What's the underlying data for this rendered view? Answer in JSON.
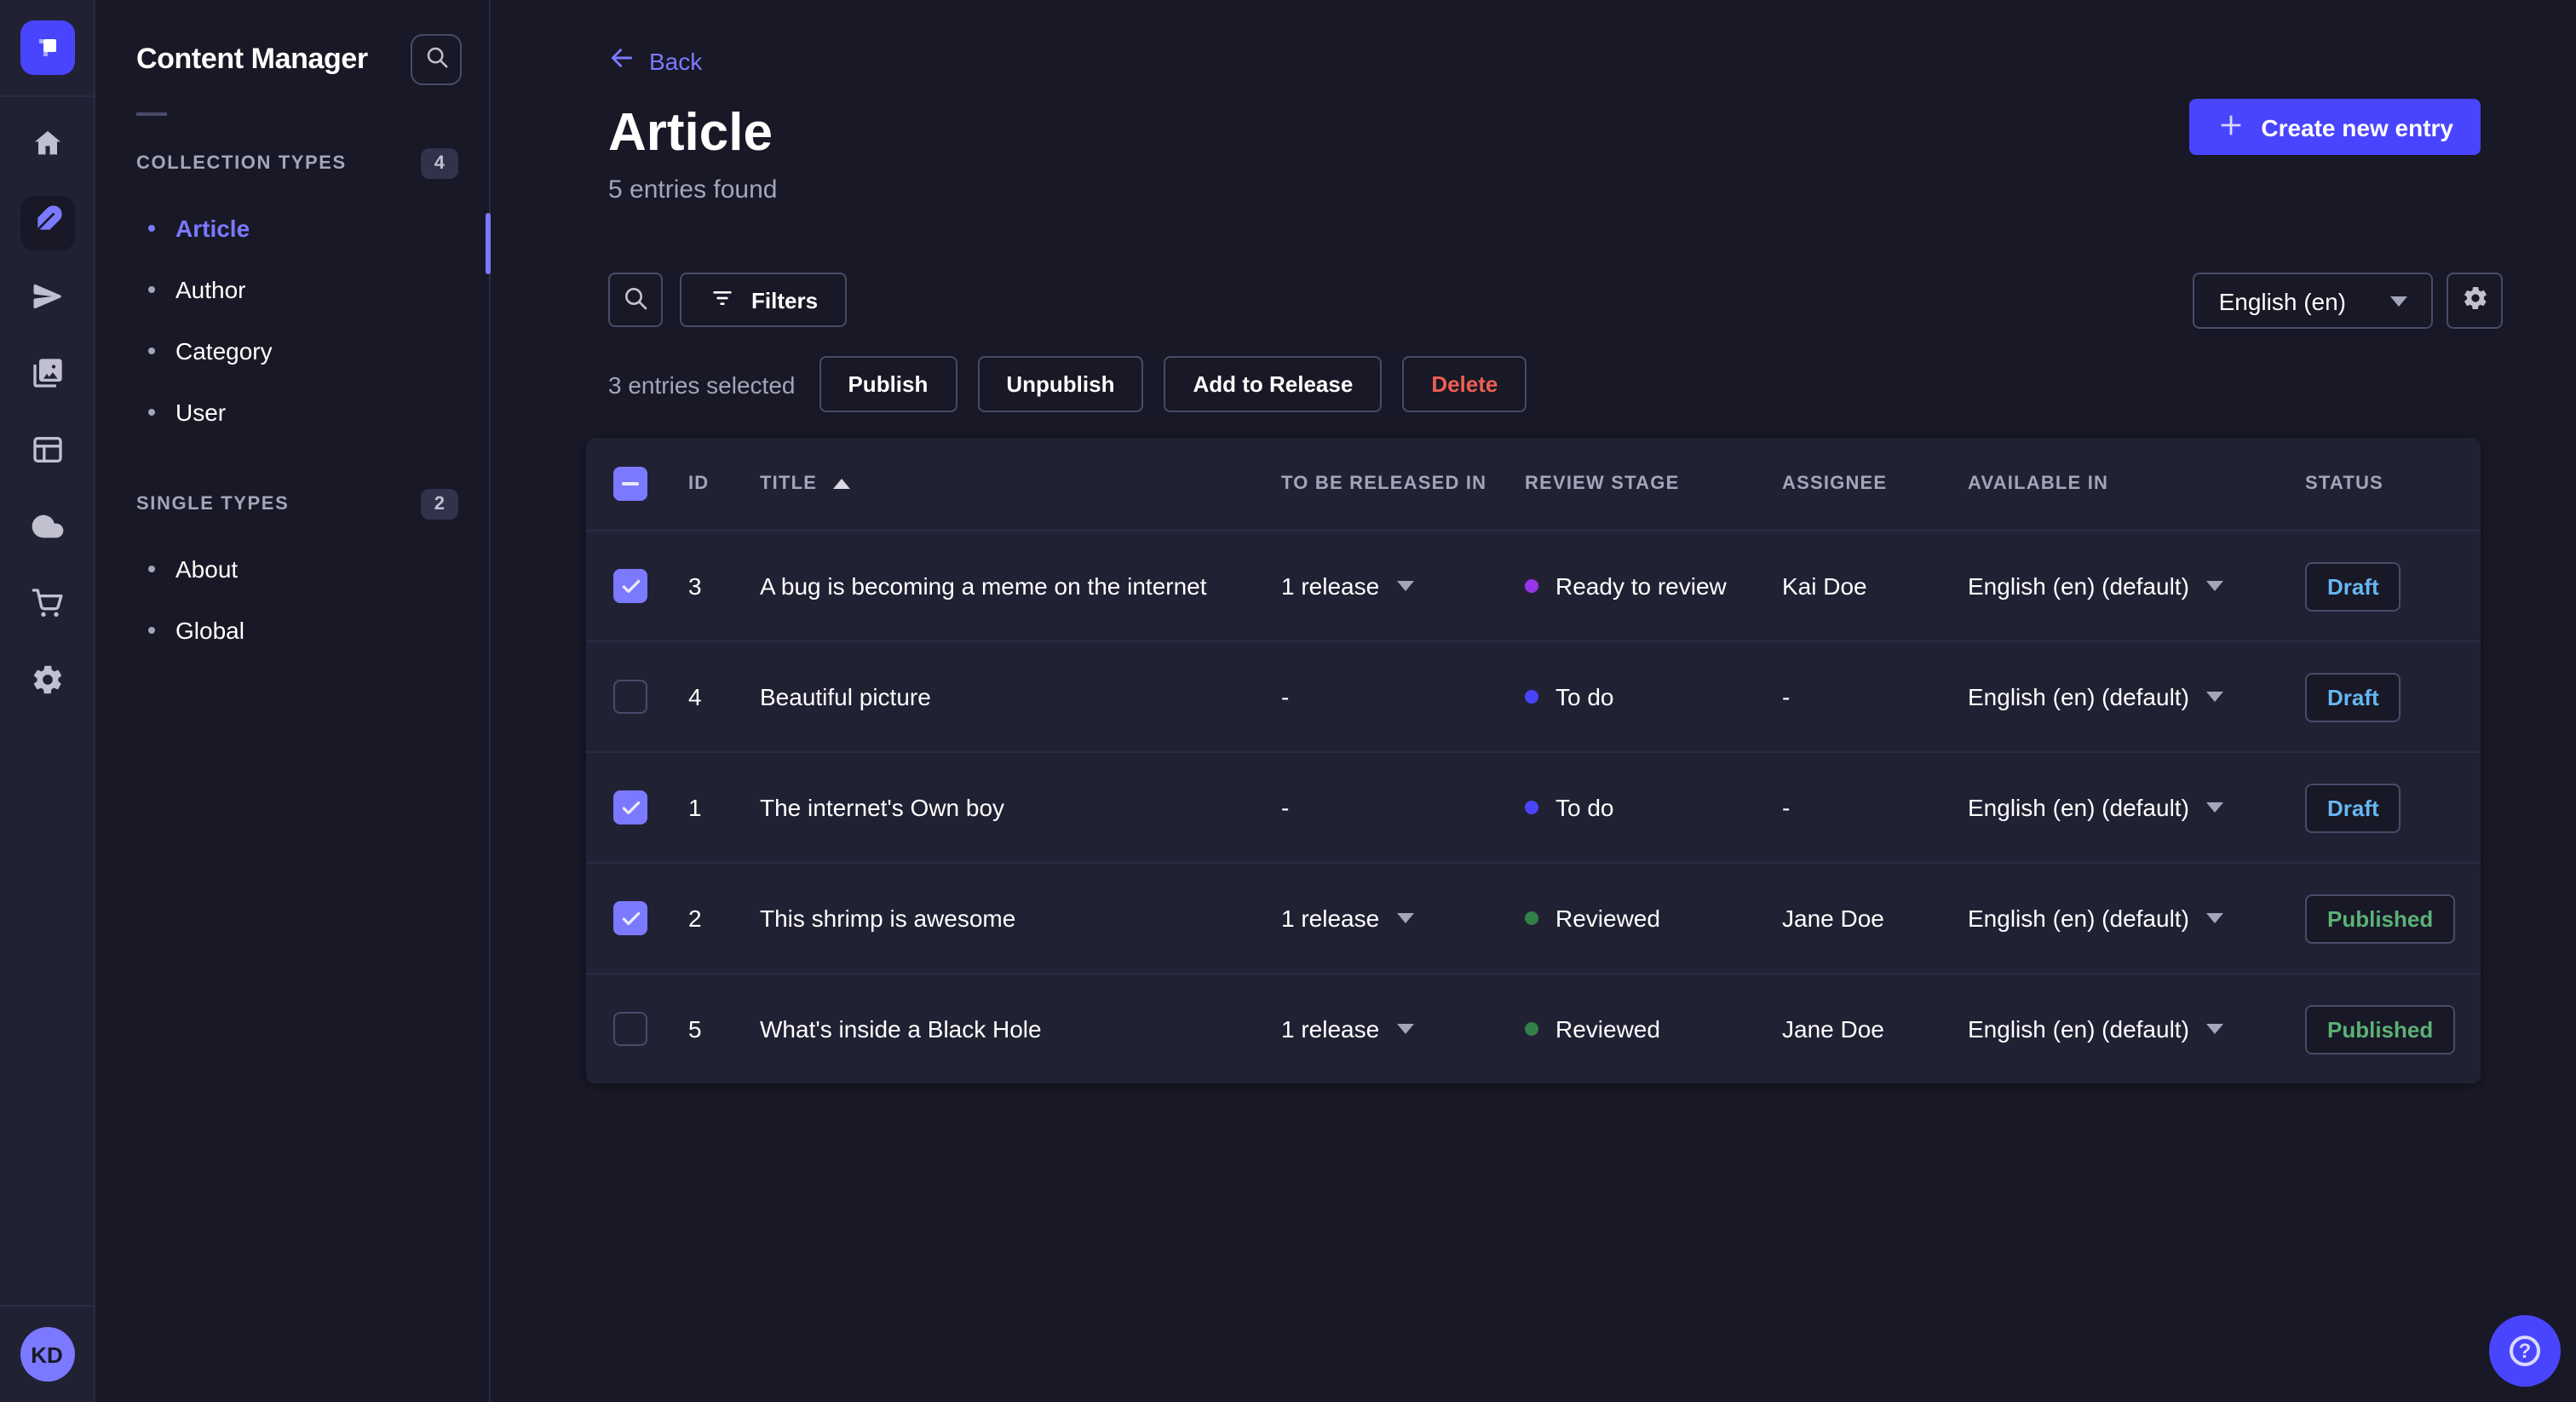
{
  "colors": {
    "accent": "#4945ff",
    "link": "#7b79ff",
    "danger": "#ee5e52",
    "draft": "#66b7f1",
    "published": "#5cb176"
  },
  "rail": {
    "icons": [
      "home",
      "content-manager",
      "releases",
      "media-library",
      "content-type-builder",
      "cloud",
      "marketplace",
      "settings"
    ],
    "active_icon": "content-manager",
    "avatar_initials": "KD"
  },
  "nav": {
    "title": "Content Manager",
    "sections": [
      {
        "label": "COLLECTION TYPES",
        "badge": "4",
        "items": [
          {
            "label": "Article",
            "active": true
          },
          {
            "label": "Author",
            "active": false
          },
          {
            "label": "Category",
            "active": false
          },
          {
            "label": "User",
            "active": false
          }
        ]
      },
      {
        "label": "SINGLE TYPES",
        "badge": "2",
        "items": [
          {
            "label": "About",
            "active": false
          },
          {
            "label": "Global",
            "active": false
          }
        ]
      }
    ]
  },
  "header": {
    "back_label": "Back",
    "title": "Article",
    "subtitle": "5 entries found",
    "create_button": "Create new entry"
  },
  "toolbar": {
    "filters_label": "Filters",
    "locale_value": "English (en)"
  },
  "selection": {
    "label": "3 entries selected",
    "publish": "Publish",
    "unpublish": "Unpublish",
    "add_to_release": "Add to Release",
    "delete": "Delete"
  },
  "table": {
    "header_checkbox_indeterminate": true,
    "sort": {
      "column": "TITLE",
      "direction": "asc"
    },
    "columns": [
      "ID",
      "TITLE",
      "TO BE RELEASED IN",
      "REVIEW STAGE",
      "ASSIGNEE",
      "AVAILABLE IN",
      "STATUS"
    ],
    "rows": [
      {
        "checked": true,
        "id": "3",
        "title": "A bug is becoming a meme on the internet",
        "release": "1 release",
        "has_release": true,
        "stage": "Ready to review",
        "stage_color": "#9736e8",
        "assignee": "Kai Doe",
        "locale": "English (en) (default)",
        "status": "Draft",
        "status_color": "#66b7f1"
      },
      {
        "checked": false,
        "id": "4",
        "title": "Beautiful picture",
        "release": "-",
        "has_release": false,
        "stage": "To do",
        "stage_color": "#4945ff",
        "assignee": "-",
        "locale": "English (en) (default)",
        "status": "Draft",
        "status_color": "#66b7f1"
      },
      {
        "checked": true,
        "id": "1",
        "title": "The internet's Own boy",
        "release": "-",
        "has_release": false,
        "stage": "To do",
        "stage_color": "#4945ff",
        "assignee": "-",
        "locale": "English (en) (default)",
        "status": "Draft",
        "status_color": "#66b7f1"
      },
      {
        "checked": true,
        "id": "2",
        "title": "This shrimp is awesome",
        "release": "1 release",
        "has_release": true,
        "stage": "Reviewed",
        "stage_color": "#328048",
        "assignee": "Jane Doe",
        "locale": "English (en) (default)",
        "status": "Published",
        "status_color": "#5cb176"
      },
      {
        "checked": false,
        "id": "5",
        "title": "What's inside a Black Hole",
        "release": "1 release",
        "has_release": true,
        "stage": "Reviewed",
        "stage_color": "#328048",
        "assignee": "Jane Doe",
        "locale": "English (en) (default)",
        "status": "Published",
        "status_color": "#5cb176"
      }
    ]
  }
}
